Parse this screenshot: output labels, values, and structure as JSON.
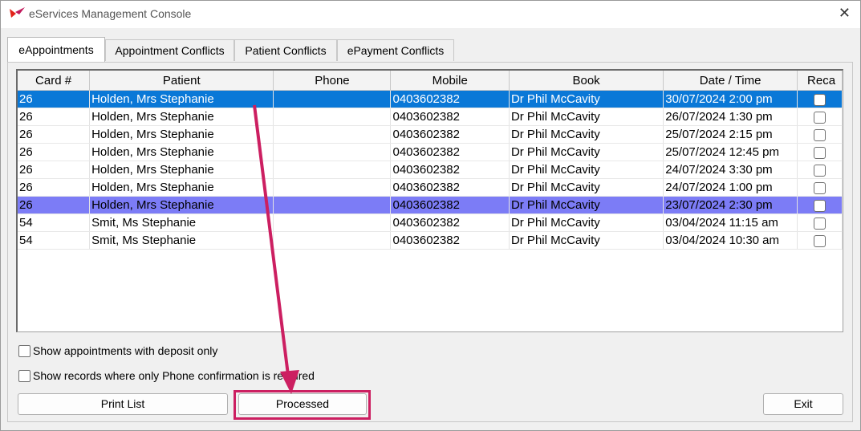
{
  "window": {
    "title": "eServices Management Console",
    "close_glyph": "✕"
  },
  "tabs": [
    {
      "label": "eAppointments",
      "active": true
    },
    {
      "label": "Appointment Conflicts",
      "active": false
    },
    {
      "label": "Patient Conflicts",
      "active": false
    },
    {
      "label": "ePayment Conflicts",
      "active": false
    }
  ],
  "table": {
    "columns": [
      "Card #",
      "Patient",
      "Phone",
      "Mobile",
      "Book",
      "Date / Time",
      "Reca"
    ],
    "rows": [
      {
        "card": "26",
        "patient": "Holden, Mrs Stephanie",
        "phone": "",
        "mobile": "0403602382",
        "book": "Dr Phil McCavity",
        "datetime": "30/07/2024 2:00 pm",
        "recall": false,
        "state": "selected"
      },
      {
        "card": "26",
        "patient": "Holden, Mrs Stephanie",
        "phone": "",
        "mobile": "0403602382",
        "book": "Dr Phil McCavity",
        "datetime": "26/07/2024 1:30 pm",
        "recall": false,
        "state": ""
      },
      {
        "card": "26",
        "patient": "Holden, Mrs Stephanie",
        "phone": "",
        "mobile": "0403602382",
        "book": "Dr Phil McCavity",
        "datetime": "25/07/2024 2:15 pm",
        "recall": false,
        "state": ""
      },
      {
        "card": "26",
        "patient": "Holden, Mrs Stephanie",
        "phone": "",
        "mobile": "0403602382",
        "book": "Dr Phil McCavity",
        "datetime": "25/07/2024 12:45 pm",
        "recall": false,
        "state": ""
      },
      {
        "card": "26",
        "patient": "Holden, Mrs Stephanie",
        "phone": "",
        "mobile": "0403602382",
        "book": "Dr Phil McCavity",
        "datetime": "24/07/2024 3:30 pm",
        "recall": false,
        "state": ""
      },
      {
        "card": "26",
        "patient": "Holden, Mrs Stephanie",
        "phone": "",
        "mobile": "0403602382",
        "book": "Dr Phil McCavity",
        "datetime": "24/07/2024 1:00 pm",
        "recall": false,
        "state": ""
      },
      {
        "card": "26",
        "patient": "Holden, Mrs Stephanie",
        "phone": "",
        "mobile": "0403602382",
        "book": "Dr Phil McCavity",
        "datetime": "23/07/2024 2:30 pm",
        "recall": false,
        "state": "highlighted"
      },
      {
        "card": "54",
        "patient": "Smit, Ms Stephanie",
        "phone": "",
        "mobile": "0403602382",
        "book": "Dr Phil McCavity",
        "datetime": "03/04/2024 11:15 am",
        "recall": false,
        "state": ""
      },
      {
        "card": "54",
        "patient": "Smit, Ms Stephanie",
        "phone": "",
        "mobile": "0403602382",
        "book": "Dr Phil McCavity",
        "datetime": "03/04/2024 10:30 am",
        "recall": false,
        "state": ""
      }
    ]
  },
  "options": {
    "deposit_only": "Show appointments with deposit only",
    "phone_confirmation": "Show records where only Phone confirmation is required"
  },
  "buttons": {
    "print": "Print List",
    "processed": "Processed",
    "exit": "Exit"
  },
  "colors": {
    "selected_row": "#0a78d7",
    "highlighted_row": "#7c7cf6",
    "annotation": "#cc1f61"
  },
  "annotation": {
    "type": "arrow-and-box",
    "target": "processed-button"
  }
}
